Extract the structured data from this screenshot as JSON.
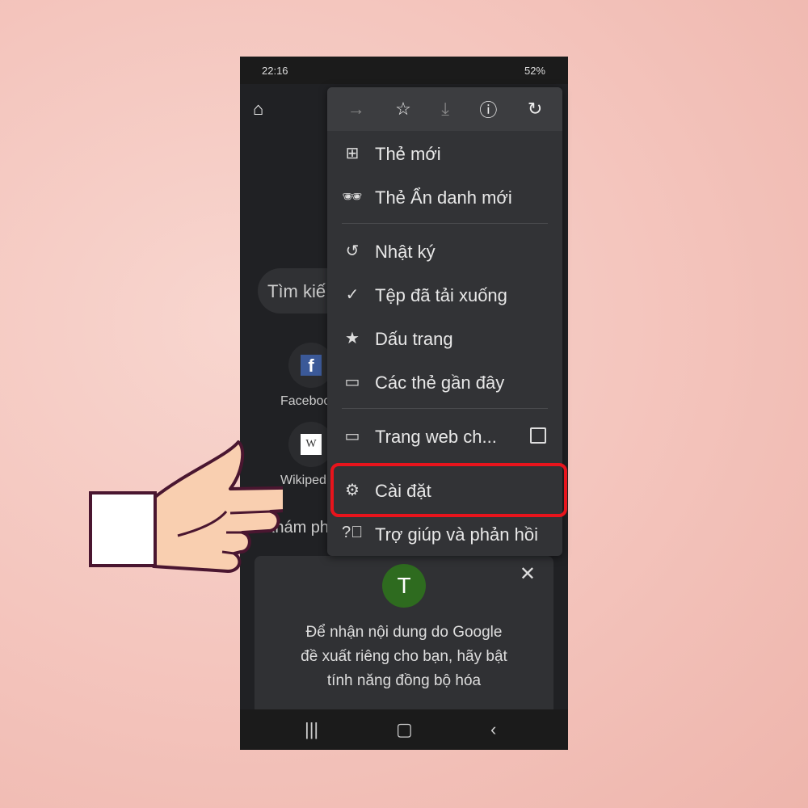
{
  "status": {
    "time": "22:16",
    "right": "52%"
  },
  "search": {
    "placeholder": "Tìm kiế"
  },
  "shortcuts": [
    {
      "label": "Faceboo",
      "icon": "facebook-icon"
    },
    {
      "label": "Wikiped",
      "icon": "wikipedia-icon"
    }
  ],
  "explore_label": "Khám phá",
  "menu": {
    "toolbar": [
      "forward-icon",
      "star-icon",
      "download-icon",
      "info-icon",
      "reload-icon"
    ],
    "items": [
      {
        "label": "Thẻ mới",
        "icon": "new-tab-icon"
      },
      {
        "label": "Thẻ Ẩn danh mới",
        "icon": "incognito-icon"
      },
      {
        "label": "Nhật ký",
        "icon": "history-icon"
      },
      {
        "label": "Tệp đã tải xuống",
        "icon": "downloads-icon"
      },
      {
        "label": "Dấu trang",
        "icon": "bookmark-star-icon"
      },
      {
        "label": "Các thẻ gần đây",
        "icon": "recent-tabs-icon"
      },
      {
        "label": "Trang web ch...",
        "icon": "desktop-icon"
      },
      {
        "label": "Cài đặt",
        "icon": "gear-icon"
      },
      {
        "label": "Trợ giúp và phản hồi",
        "icon": "help-icon"
      }
    ]
  },
  "sync_card": {
    "avatar": "T",
    "text": [
      "Để nhận nội dung do Google",
      "đề xuất riêng cho bạn, hãy bật",
      "tính năng đồng bộ hóa"
    ]
  },
  "colors": {
    "highlight": "#e8141c",
    "avatar": "#2e6b1f"
  }
}
